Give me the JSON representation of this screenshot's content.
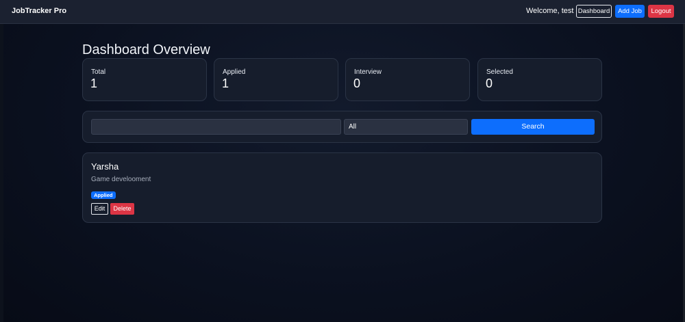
{
  "navbar": {
    "brand": "JobTracker Pro",
    "welcome": "Welcome, test",
    "dashboard_label": "Dashboard",
    "add_job_label": "Add Job",
    "logout_label": "Logout"
  },
  "page": {
    "title": "Dashboard Overview"
  },
  "stats": [
    {
      "label": "Total",
      "value": "1"
    },
    {
      "label": "Applied",
      "value": "1"
    },
    {
      "label": "Interview",
      "value": "0"
    },
    {
      "label": "Selected",
      "value": "0"
    }
  ],
  "search": {
    "query_value": "",
    "status_selected": "All",
    "button_label": "Search"
  },
  "jobs": [
    {
      "company": "Yarsha",
      "role": "Game develooment",
      "status": "Applied",
      "edit_label": "Edit",
      "delete_label": "Delete"
    }
  ],
  "colors": {
    "primary": "#0d6efd",
    "danger": "#dc3545",
    "card_bg": "#161d2c",
    "navbar_bg": "#1b2130"
  }
}
